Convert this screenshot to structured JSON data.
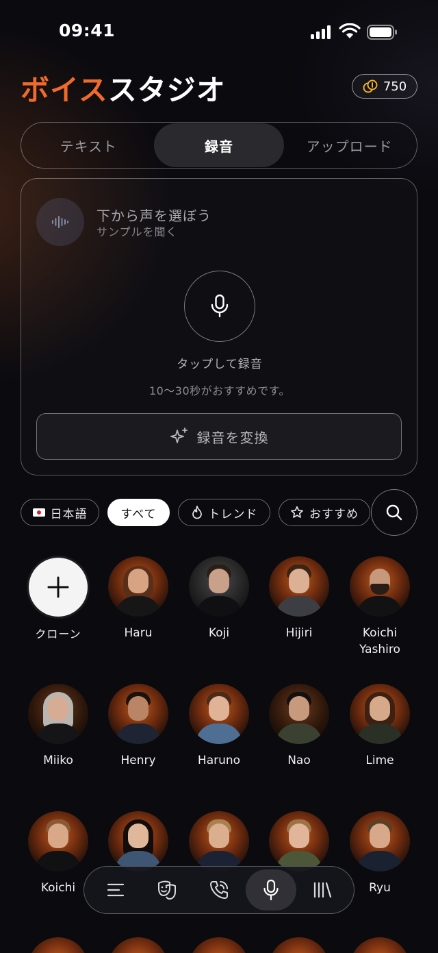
{
  "status_bar": {
    "time": "09:41"
  },
  "header": {
    "title_accent": "ボイス",
    "title_rest": "スタジオ",
    "credits": "750"
  },
  "tabs": [
    {
      "label": "テキスト",
      "active": false
    },
    {
      "label": "録音",
      "active": true
    },
    {
      "label": "アップロード",
      "active": false
    }
  ],
  "recorder": {
    "voice_title": "下から声を選ぼう",
    "voice_subtitle": "サンプルを聞く",
    "tap_label": "タップして録音",
    "hint": "10〜30秒がおすすめです。",
    "convert_label": "録音を変換"
  },
  "filters": {
    "language": "日本語",
    "all": "すべて",
    "trend": "トレンド",
    "recommended": "おすすめ"
  },
  "voices": {
    "clone_label": "クローン",
    "row1": [
      "Haru",
      "Koji",
      "Hijiri",
      "Koichi\nYashiro"
    ],
    "row2": [
      "Miiko",
      "Henry",
      "Haruno",
      "Nao",
      "Lime"
    ],
    "row3": [
      "Koichi",
      "",
      "",
      "",
      "Ryu"
    ]
  },
  "colors": {
    "accent": "#f06a2b",
    "background": "#0a0a0f"
  },
  "icons": {
    "nav": [
      "menu-icon",
      "masks-icon",
      "phone-icon",
      "microphone-icon",
      "library-icon"
    ]
  }
}
